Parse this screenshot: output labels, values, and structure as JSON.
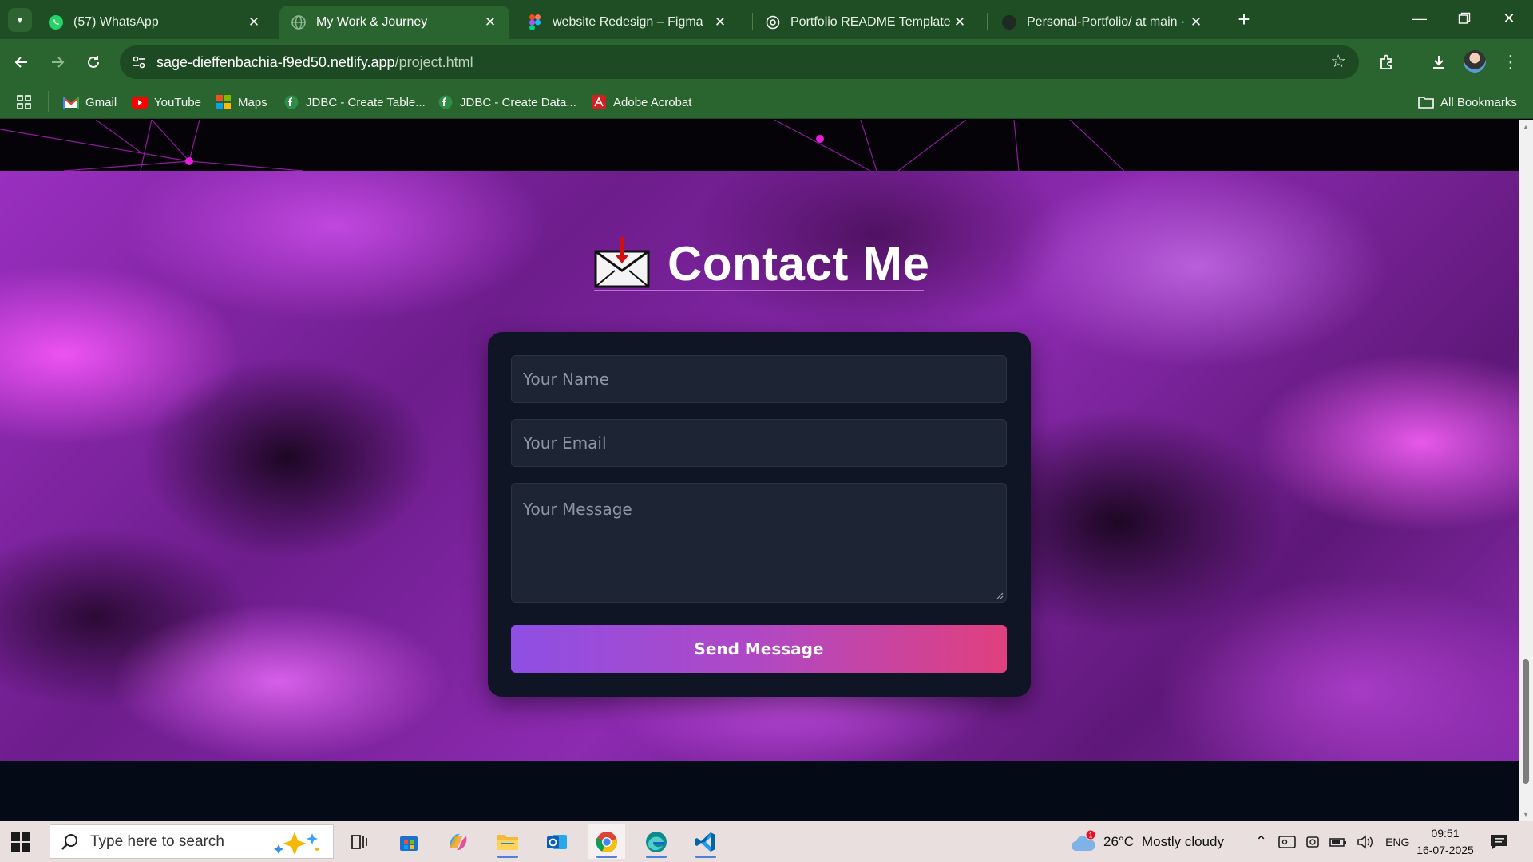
{
  "browser": {
    "tabs": [
      {
        "title": "(57) WhatsApp",
        "icon": "whatsapp-icon",
        "active": false
      },
      {
        "title": "My Work & Journey",
        "icon": "globe-icon",
        "active": true
      },
      {
        "title": "website Redesign – Figma",
        "icon": "figma-icon",
        "active": false
      },
      {
        "title": "Portfolio README Template",
        "icon": "openai-icon",
        "active": false
      },
      {
        "title": "Personal-Portfolio/ at main · Ab",
        "icon": "github-icon",
        "active": false
      }
    ],
    "url_host": "sage-dieffenbachia-f9ed50.netlify.app",
    "url_path": "/project.html",
    "bookmarks": [
      {
        "label": "Gmail",
        "icon": "gmail-icon"
      },
      {
        "label": "YouTube",
        "icon": "youtube-icon"
      },
      {
        "label": "Maps",
        "icon": "maps-icon"
      },
      {
        "label": "JDBC - Create Table...",
        "icon": "jdbc-icon"
      },
      {
        "label": "JDBC - Create Data...",
        "icon": "jdbc-icon"
      },
      {
        "label": "Adobe Acrobat",
        "icon": "acrobat-icon"
      }
    ],
    "all_bookmarks": "All Bookmarks",
    "theme_color": "#2a6530"
  },
  "page": {
    "heading": "Contact Me",
    "heading_icon": "incoming-envelope-icon",
    "form": {
      "name_placeholder": "Your Name",
      "email_placeholder": "Your Email",
      "message_placeholder": "Your Message",
      "submit_label": "Send Message"
    },
    "accent_gradient": [
      "#8e4fe4",
      "#e0407e"
    ],
    "card_color": "#0f1524"
  },
  "taskbar": {
    "search_placeholder": "Type here to search",
    "weather": {
      "temp": "26°C",
      "condition": "Mostly cloudy",
      "alert_count": "1"
    },
    "language": "ENG",
    "time": "09:51",
    "date": "16-07-2025"
  }
}
